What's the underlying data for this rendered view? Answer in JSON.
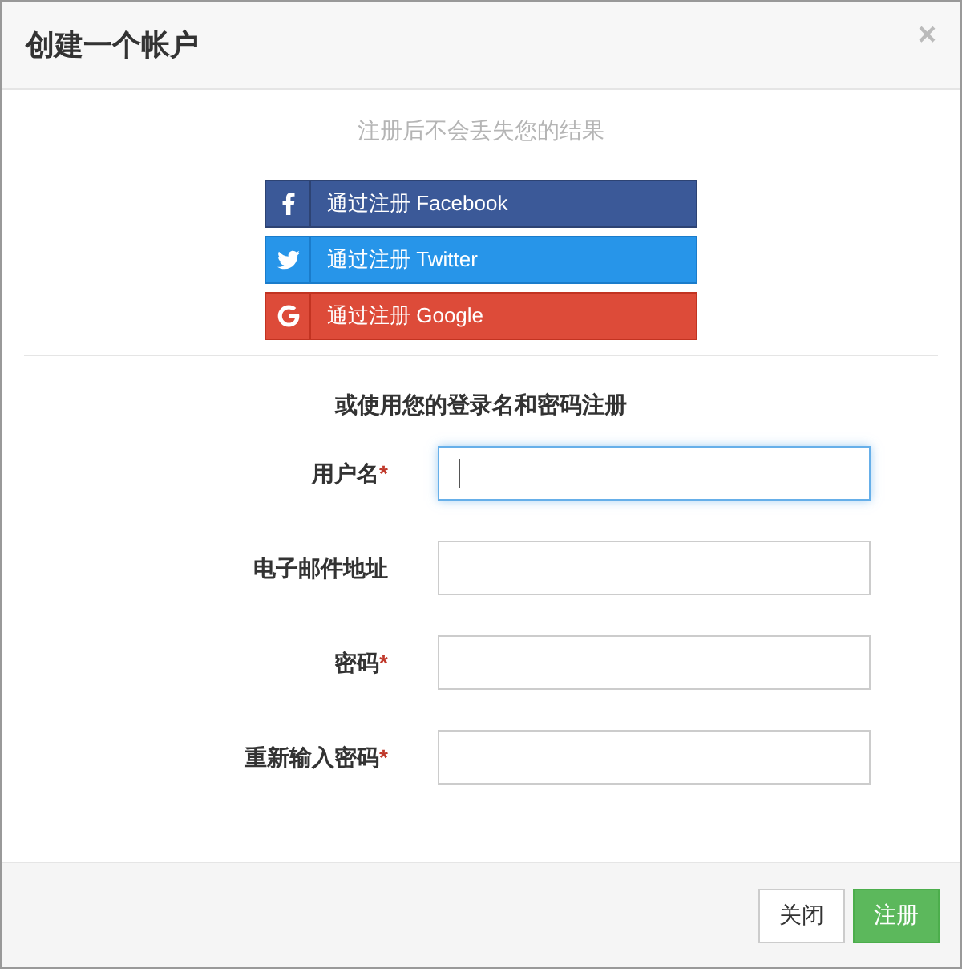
{
  "dialog": {
    "title": "创建一个帐户",
    "close": "×"
  },
  "subtitle": "注册后不会丢失您的结果",
  "social_buttons": [
    {
      "kind": "facebook",
      "label": "通过注册 Facebook"
    },
    {
      "kind": "twitter",
      "label": "通过注册 Twitter"
    },
    {
      "kind": "google",
      "label": "通过注册 Google"
    }
  ],
  "form_heading": "或使用您的登录名和密码注册",
  "fields": [
    {
      "label": "用户名",
      "required_mark": "*",
      "focused": true
    },
    {
      "label": "电子邮件地址",
      "focused": false
    },
    {
      "label": "密码",
      "required_mark": "*",
      "focused": false
    },
    {
      "label": "重新输入密码",
      "required_mark": "*",
      "focused": false
    }
  ],
  "footer_buttons": [
    {
      "kind": "default",
      "label": "关闭"
    },
    {
      "kind": "primary",
      "label": "注册"
    }
  ]
}
